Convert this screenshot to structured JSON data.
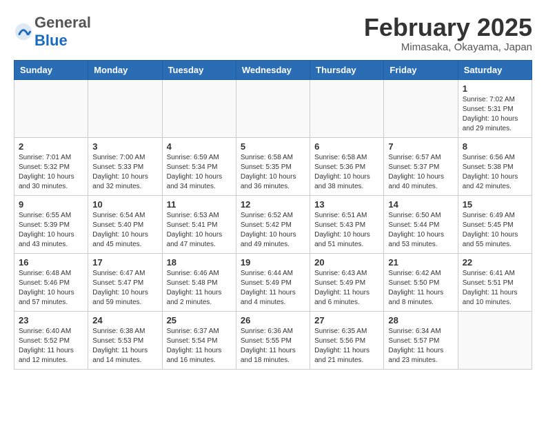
{
  "header": {
    "logo_general": "General",
    "logo_blue": "Blue",
    "month_year": "February 2025",
    "location": "Mimasaka, Okayama, Japan"
  },
  "weekdays": [
    "Sunday",
    "Monday",
    "Tuesday",
    "Wednesday",
    "Thursday",
    "Friday",
    "Saturday"
  ],
  "weeks": [
    [
      {
        "day": "",
        "detail": ""
      },
      {
        "day": "",
        "detail": ""
      },
      {
        "day": "",
        "detail": ""
      },
      {
        "day": "",
        "detail": ""
      },
      {
        "day": "",
        "detail": ""
      },
      {
        "day": "",
        "detail": ""
      },
      {
        "day": "1",
        "detail": "Sunrise: 7:02 AM\nSunset: 5:31 PM\nDaylight: 10 hours\nand 29 minutes."
      }
    ],
    [
      {
        "day": "2",
        "detail": "Sunrise: 7:01 AM\nSunset: 5:32 PM\nDaylight: 10 hours\nand 30 minutes."
      },
      {
        "day": "3",
        "detail": "Sunrise: 7:00 AM\nSunset: 5:33 PM\nDaylight: 10 hours\nand 32 minutes."
      },
      {
        "day": "4",
        "detail": "Sunrise: 6:59 AM\nSunset: 5:34 PM\nDaylight: 10 hours\nand 34 minutes."
      },
      {
        "day": "5",
        "detail": "Sunrise: 6:58 AM\nSunset: 5:35 PM\nDaylight: 10 hours\nand 36 minutes."
      },
      {
        "day": "6",
        "detail": "Sunrise: 6:58 AM\nSunset: 5:36 PM\nDaylight: 10 hours\nand 38 minutes."
      },
      {
        "day": "7",
        "detail": "Sunrise: 6:57 AM\nSunset: 5:37 PM\nDaylight: 10 hours\nand 40 minutes."
      },
      {
        "day": "8",
        "detail": "Sunrise: 6:56 AM\nSunset: 5:38 PM\nDaylight: 10 hours\nand 42 minutes."
      }
    ],
    [
      {
        "day": "9",
        "detail": "Sunrise: 6:55 AM\nSunset: 5:39 PM\nDaylight: 10 hours\nand 43 minutes."
      },
      {
        "day": "10",
        "detail": "Sunrise: 6:54 AM\nSunset: 5:40 PM\nDaylight: 10 hours\nand 45 minutes."
      },
      {
        "day": "11",
        "detail": "Sunrise: 6:53 AM\nSunset: 5:41 PM\nDaylight: 10 hours\nand 47 minutes."
      },
      {
        "day": "12",
        "detail": "Sunrise: 6:52 AM\nSunset: 5:42 PM\nDaylight: 10 hours\nand 49 minutes."
      },
      {
        "day": "13",
        "detail": "Sunrise: 6:51 AM\nSunset: 5:43 PM\nDaylight: 10 hours\nand 51 minutes."
      },
      {
        "day": "14",
        "detail": "Sunrise: 6:50 AM\nSunset: 5:44 PM\nDaylight: 10 hours\nand 53 minutes."
      },
      {
        "day": "15",
        "detail": "Sunrise: 6:49 AM\nSunset: 5:45 PM\nDaylight: 10 hours\nand 55 minutes."
      }
    ],
    [
      {
        "day": "16",
        "detail": "Sunrise: 6:48 AM\nSunset: 5:46 PM\nDaylight: 10 hours\nand 57 minutes."
      },
      {
        "day": "17",
        "detail": "Sunrise: 6:47 AM\nSunset: 5:47 PM\nDaylight: 10 hours\nand 59 minutes."
      },
      {
        "day": "18",
        "detail": "Sunrise: 6:46 AM\nSunset: 5:48 PM\nDaylight: 11 hours\nand 2 minutes."
      },
      {
        "day": "19",
        "detail": "Sunrise: 6:44 AM\nSunset: 5:49 PM\nDaylight: 11 hours\nand 4 minutes."
      },
      {
        "day": "20",
        "detail": "Sunrise: 6:43 AM\nSunset: 5:49 PM\nDaylight: 11 hours\nand 6 minutes."
      },
      {
        "day": "21",
        "detail": "Sunrise: 6:42 AM\nSunset: 5:50 PM\nDaylight: 11 hours\nand 8 minutes."
      },
      {
        "day": "22",
        "detail": "Sunrise: 6:41 AM\nSunset: 5:51 PM\nDaylight: 11 hours\nand 10 minutes."
      }
    ],
    [
      {
        "day": "23",
        "detail": "Sunrise: 6:40 AM\nSunset: 5:52 PM\nDaylight: 11 hours\nand 12 minutes."
      },
      {
        "day": "24",
        "detail": "Sunrise: 6:38 AM\nSunset: 5:53 PM\nDaylight: 11 hours\nand 14 minutes."
      },
      {
        "day": "25",
        "detail": "Sunrise: 6:37 AM\nSunset: 5:54 PM\nDaylight: 11 hours\nand 16 minutes."
      },
      {
        "day": "26",
        "detail": "Sunrise: 6:36 AM\nSunset: 5:55 PM\nDaylight: 11 hours\nand 18 minutes."
      },
      {
        "day": "27",
        "detail": "Sunrise: 6:35 AM\nSunset: 5:56 PM\nDaylight: 11 hours\nand 21 minutes."
      },
      {
        "day": "28",
        "detail": "Sunrise: 6:34 AM\nSunset: 5:57 PM\nDaylight: 11 hours\nand 23 minutes."
      },
      {
        "day": "",
        "detail": ""
      }
    ]
  ]
}
